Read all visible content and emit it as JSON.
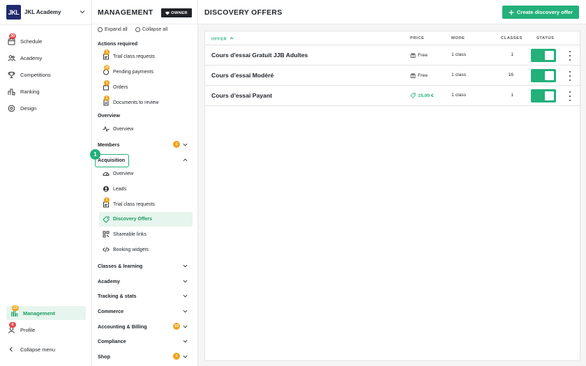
{
  "brand": {
    "logo": "JKL",
    "name": "JKL Academy"
  },
  "nav": {
    "items": [
      {
        "label": "Schedule",
        "icon": "calendar-icon",
        "badge": "30"
      },
      {
        "label": "Academy",
        "icon": "people-icon"
      },
      {
        "label": "Competitions",
        "icon": "trophy-icon"
      },
      {
        "label": "Ranking",
        "icon": "podium-icon"
      },
      {
        "label": "Design",
        "icon": "palette-icon"
      }
    ],
    "management": {
      "label": "Management",
      "badge": "23"
    },
    "profile": {
      "label": "Profile",
      "badge": "6"
    },
    "collapse": "Collapse menu"
  },
  "panel": {
    "title": "MANAGEMENT",
    "owner": "OWNER",
    "expand_all": "Expand all",
    "collapse_all": "Collapse all",
    "actions_required": {
      "title": "Actions required",
      "items": [
        {
          "label": "Trial class requests",
          "badge": "1"
        },
        {
          "label": "Pending payments",
          "badge": "10"
        },
        {
          "label": "Orders",
          "badge": "1"
        },
        {
          "label": "Documents to review",
          "badge": "1"
        }
      ]
    },
    "overview_section": {
      "title": "Overview",
      "item": "Overview"
    },
    "members": {
      "title": "Members",
      "badge": "1"
    },
    "acquisition": {
      "title": "Acquisition",
      "step": "1",
      "items": [
        {
          "label": "Overview"
        },
        {
          "label": "Leads"
        },
        {
          "label": "Trial class requests",
          "badge": "1"
        },
        {
          "label": "Discovery Offers"
        },
        {
          "label": "Shareable links"
        },
        {
          "label": "Booking widgets"
        }
      ]
    },
    "sections": [
      {
        "title": "Classes & learning"
      },
      {
        "title": "Academy"
      },
      {
        "title": "Tracking & stats"
      },
      {
        "title": "Commerce"
      },
      {
        "title": "Accounting & Billing",
        "badge": "10"
      },
      {
        "title": "Compliance"
      },
      {
        "title": "Shop",
        "badge": "1"
      }
    ]
  },
  "main": {
    "title": "DISCOVERY OFFERS",
    "create_button": "Create discovery offer",
    "columns": {
      "offer": "OFFER",
      "price": "PRICE",
      "mode": "MODE",
      "classes": "CLASSES",
      "status": "STATUS"
    },
    "rows": [
      {
        "name": "Cours d'essai Gratuit JJB Adultes",
        "price": "Free",
        "mode": "1 class",
        "classes": "1",
        "enabled": true
      },
      {
        "name": "Cours d’essai Modéré",
        "price": "Free",
        "mode": "1 class",
        "classes": "16",
        "enabled": true
      },
      {
        "name": "Cours d’essai Payant",
        "price": "15,00 €",
        "mode": "1 class",
        "classes": "1",
        "enabled": true
      }
    ]
  },
  "colors": {
    "accent": "#23b07a",
    "badge_red": "#e54b4b",
    "badge_orange": "#f0a31a",
    "logo_bg": "#1f2a6e"
  }
}
